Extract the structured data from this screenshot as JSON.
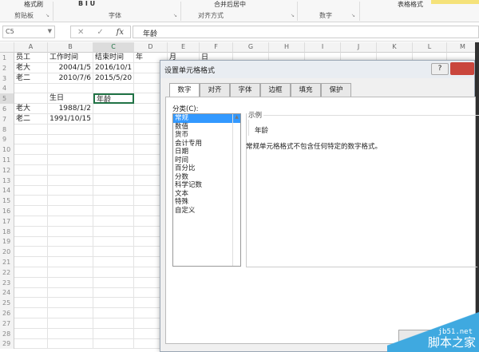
{
  "ribbon": {
    "format_painter": "格式刷",
    "merge_center": "合并后居中",
    "table_format": "表格格式",
    "groups": [
      "剪贴板",
      "字体",
      "对齐方式",
      "数字"
    ]
  },
  "formula_bar": {
    "name_box": "C5",
    "fx": "fx",
    "cancel": "✕",
    "enter": "✓",
    "value": "年龄"
  },
  "columns": [
    "A",
    "B",
    "C",
    "D",
    "E",
    "F",
    "G",
    "H",
    "I",
    "J",
    "K",
    "L",
    "M"
  ],
  "rows": [
    "1",
    "2",
    "3",
    "4",
    "5",
    "6",
    "7",
    "8",
    "9",
    "10",
    "11",
    "12",
    "13",
    "14",
    "15",
    "16",
    "17",
    "18",
    "19",
    "20",
    "21",
    "22",
    "23",
    "24",
    "25",
    "26",
    "27",
    "28",
    "29"
  ],
  "cells": {
    "A1": "员工",
    "B1": "工作时间",
    "C1": "结束时间",
    "D1": "年",
    "E1": "月",
    "F1": "日",
    "A2": "老大",
    "B2": "2004/1/5",
    "C2": "2016/10/1",
    "A3": "老二",
    "B3": "2010/7/6",
    "C3": "2015/5/20",
    "B5": "生日",
    "C5": "年龄",
    "A6": "老大",
    "B6": "1988/1/2",
    "A7": "老二",
    "B7": "1991/10/15"
  },
  "dialog": {
    "title": "设置单元格格式",
    "help": "?",
    "tabs": [
      "数字",
      "对齐",
      "字体",
      "边框",
      "填充",
      "保护"
    ],
    "category_label": "分类(C):",
    "categories": [
      "常规",
      "数值",
      "货币",
      "会计专用",
      "日期",
      "时间",
      "百分比",
      "分数",
      "科学记数",
      "文本",
      "特殊",
      "自定义"
    ],
    "selected_category": "常规",
    "sample_label": "示例",
    "sample_value": "年龄",
    "description": "常规单元格格式不包含任何特定的数字格式。"
  },
  "watermark": {
    "site": "jb51.net",
    "name": "脚本之家"
  }
}
